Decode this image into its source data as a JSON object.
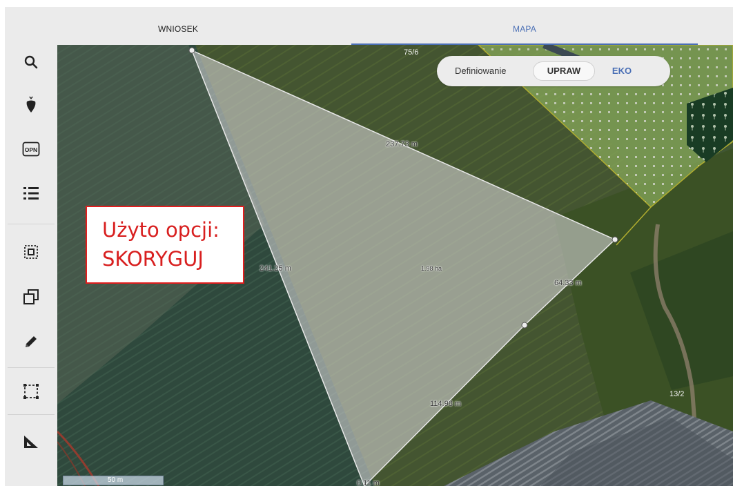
{
  "tabs": [
    {
      "label": "WNIOSEK",
      "active": false
    },
    {
      "label": "MAPA",
      "active": true
    }
  ],
  "sidebar": {
    "tools": [
      {
        "icon": "search-icon"
      },
      {
        "icon": "crop-vegetable-icon"
      },
      {
        "icon": "opn-icon",
        "text": "OPN"
      },
      {
        "icon": "list-icon"
      },
      {
        "icon": "select-area-icon"
      },
      {
        "icon": "copy-layers-icon"
      },
      {
        "icon": "pencil-icon"
      },
      {
        "icon": "bounding-box-icon"
      },
      {
        "icon": "measure-icon"
      }
    ]
  },
  "toggle": {
    "label": "Definiowanie",
    "options": [
      "UPRAW",
      "EKO"
    ],
    "selected": "UPRAW"
  },
  "callout": {
    "line1": "Użyto opcji:",
    "line2": "SKORYGUJ"
  },
  "map": {
    "polygon_area": "1.98 ha",
    "edges": [
      "237.73 m",
      "241.25 m",
      "64.33 m",
      "114.98 m",
      "0.11 m"
    ],
    "parcels": [
      "75/6",
      "13/2"
    ],
    "scale": "50 m"
  },
  "colors": {
    "accent": "#4a6fb5",
    "callout_border": "#e21d1d",
    "callout_text": "#d81f1f",
    "parcel_line": "#d9d53a"
  }
}
